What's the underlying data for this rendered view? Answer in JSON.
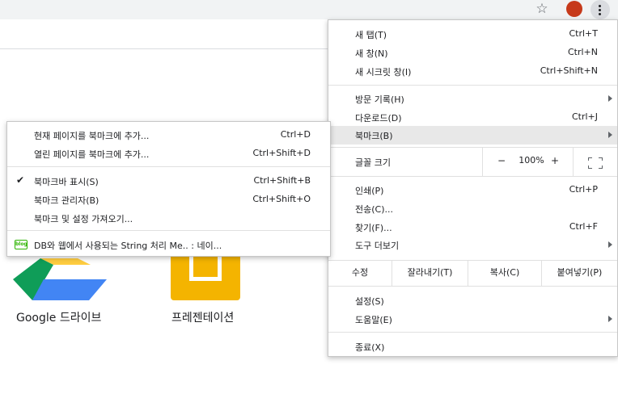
{
  "shortcuts": [
    {
      "title": "Google 드라이브",
      "icon": "google-drive-icon"
    },
    {
      "title": "프레젠테이션",
      "icon": "google-slides-icon"
    }
  ],
  "menu": {
    "new_tab": {
      "label": "새 탭(T)",
      "shortcut": "Ctrl+T"
    },
    "new_window": {
      "label": "새 창(N)",
      "shortcut": "Ctrl+N"
    },
    "new_incognito": {
      "label": "새 시크릿 창(I)",
      "shortcut": "Ctrl+Shift+N"
    },
    "history": {
      "label": "방문 기록(H)"
    },
    "downloads": {
      "label": "다운로드(D)",
      "shortcut": "Ctrl+J"
    },
    "bookmarks": {
      "label": "북마크(B)"
    },
    "zoom": {
      "label": "글꼴 크기",
      "minus": "−",
      "value": "100%",
      "plus": "+"
    },
    "print": {
      "label": "인쇄(P)",
      "shortcut": "Ctrl+P"
    },
    "cast": {
      "label": "전송(C)..."
    },
    "find": {
      "label": "찾기(F)...",
      "shortcut": "Ctrl+F"
    },
    "more_tools": {
      "label": "도구 더보기"
    },
    "edit": {
      "label": "수정",
      "cut": "잘라내기(T)",
      "copy": "복사(C)",
      "paste": "붙여넣기(P)"
    },
    "settings": {
      "label": "설정(S)"
    },
    "help": {
      "label": "도움말(E)"
    },
    "exit": {
      "label": "종료(X)"
    }
  },
  "bookmarks_menu": {
    "bookmark_page": {
      "label": "현재 페이지를 북마크에 추가...",
      "shortcut": "Ctrl+D"
    },
    "bookmark_open_pages": {
      "label": "열린 페이지를 북마크에 추가...",
      "shortcut": "Ctrl+Shift+D"
    },
    "show_bookmarks_bar": {
      "label": "북마크바 표시(S)",
      "shortcut": "Ctrl+Shift+B",
      "checked": true
    },
    "bookmark_manager": {
      "label": "북마크 관리자(B)",
      "shortcut": "Ctrl+Shift+O"
    },
    "import": {
      "label": "북마크 및 설정 가져오기..."
    },
    "saved_item": {
      "label": "DB와 웹에서 사용되는 String 처리 Me.. : 네이...",
      "favicon_text": "blog"
    }
  },
  "colors": {
    "toolbar_bg": "#f1f3f4",
    "highlight_bg": "#e8e8e8",
    "avatar": "#c6391a",
    "slides_yellow": "#f4b400",
    "drive_green": "#0f9d58",
    "drive_yellow": "#ffcd40",
    "drive_blue": "#4285f4",
    "naver_green": "#2db400"
  }
}
